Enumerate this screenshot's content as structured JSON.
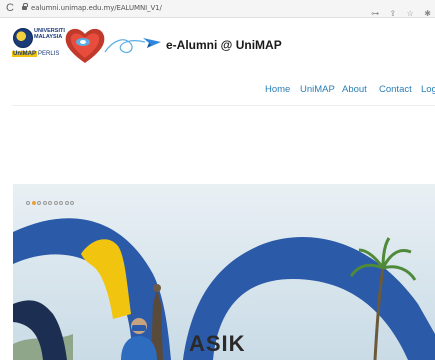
{
  "browser": {
    "url": "ealumni.unimap.edu.my/EALUMNI_V1/",
    "icons": [
      "key-icon",
      "share-icon",
      "star-icon",
      "puzzle-icon"
    ]
  },
  "header": {
    "university_lines": [
      "UNIVERSITI",
      "MALAYSIA",
      "PERLIS"
    ],
    "unimap_mark": "UniMAP",
    "site_title": "e-Alumni @ UniMAP"
  },
  "nav": {
    "items": [
      {
        "label": "Home"
      },
      {
        "label": "UniMAP"
      },
      {
        "label": "About"
      },
      {
        "label": "Contact"
      },
      {
        "label": "Login"
      }
    ]
  },
  "slider": {
    "slide_count": 9,
    "active_index": 1,
    "sign_text": "ASIK"
  },
  "colors": {
    "nav_link": "#2a7fb8",
    "active_dot": "#e8a23a",
    "arch_blue": "#2a5aa8",
    "arch_yellow": "#f1c40f"
  }
}
